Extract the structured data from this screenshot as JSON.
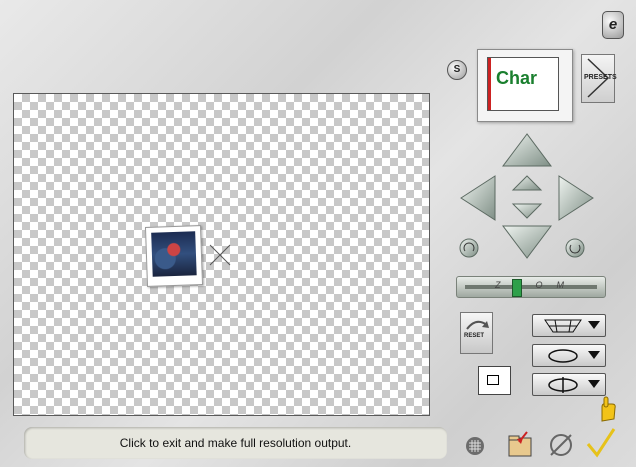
{
  "status_bar": {
    "message": "Click to exit and make full resolution output."
  },
  "preset": {
    "thumbnail_text": "Char",
    "button_label": "PRESETS"
  },
  "top_buttons": {
    "info_label": "e",
    "s_label": "S"
  },
  "zoom": {
    "label": "ZOOM"
  },
  "reset": {
    "label": "RESET"
  },
  "tools": [
    {
      "name": "perspective-grid"
    },
    {
      "name": "rotate-horizontal"
    },
    {
      "name": "rotate-vertical"
    }
  ],
  "colors": {
    "canvas_check": "#c8c8c8",
    "slider_thumb": "#2ea04a",
    "arrow_base": "#a9b8b0"
  }
}
